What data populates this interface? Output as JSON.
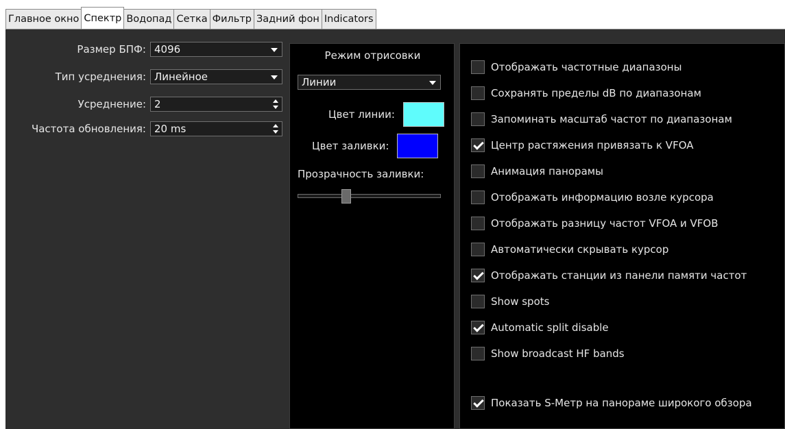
{
  "tabs": [
    "Главное окно",
    "Спектр",
    "Водопад",
    "Сетка",
    "Фильтр",
    "Задний фон",
    "Indicators"
  ],
  "active_tab": "Спектр",
  "fft": {
    "size_label": "Размер БПФ:",
    "size_value": "4096",
    "avg_type_label": "Тип усреднения:",
    "avg_type_value": "Линейное",
    "averaging_label": "Усреднение:",
    "averaging_value": "2",
    "refresh_label": "Частота обновления:",
    "refresh_value": "20 ms"
  },
  "render": {
    "title": "Режим отрисовки",
    "mode_value": "Линии",
    "line_color_label": "Цвет линии:",
    "line_color": "#5ffcfc",
    "fill_color_label": "Цвет заливки:",
    "fill_color": "#0000ff",
    "opacity_label": "Прозрачность заливки:",
    "opacity_level": 0.33
  },
  "options": [
    {
      "label": "Отображать частотные диапазоны",
      "checked": false
    },
    {
      "label": "Сохранять пределы dB по диапазонам",
      "checked": false
    },
    {
      "label": "Запоминать масштаб частот по диапазонам",
      "checked": false
    },
    {
      "label": "Центр растяжения привязать к VFOA",
      "checked": true
    },
    {
      "label": "Анимация панорамы",
      "checked": false
    },
    {
      "label": "Отображать информацию возле курсора",
      "checked": false
    },
    {
      "label": "Отображать разницу частот VFOA и VFOB",
      "checked": false
    },
    {
      "label": "Автоматически скрывать курсор",
      "checked": false
    },
    {
      "label": "Отображать станции из панели памяти частот",
      "checked": true
    },
    {
      "label": "Show spots",
      "checked": false
    },
    {
      "label": "Automatic split disable",
      "checked": true
    },
    {
      "label": "Show broadcast HF bands",
      "checked": false
    },
    {
      "label": "Показать S-Метр на панораме широкого обзора",
      "checked": true
    }
  ]
}
